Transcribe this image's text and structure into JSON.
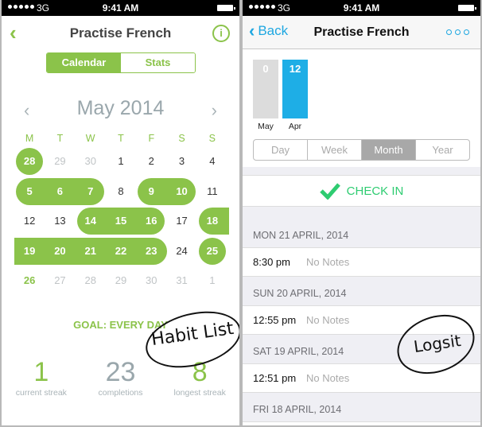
{
  "status_bar": {
    "carrier": "3G",
    "time": "9:41 AM"
  },
  "left": {
    "nav": {
      "back_icon": "chevron-left-icon",
      "title": "Practise French",
      "info_icon": "info-icon",
      "info_glyph": "i"
    },
    "segment": {
      "active": "Calendar",
      "inactive": "Stats"
    },
    "calendar": {
      "month_title": "May 2014",
      "prev_glyph": "‹",
      "next_glyph": "›",
      "weekdays": [
        "M",
        "T",
        "W",
        "T",
        "F",
        "S",
        "S"
      ],
      "weeks": [
        [
          {
            "d": "28",
            "s": "on"
          },
          {
            "d": "29",
            "s": "muted"
          },
          {
            "d": "30",
            "s": "muted"
          },
          {
            "d": "1",
            "s": "dark"
          },
          {
            "d": "2",
            "s": "dark"
          },
          {
            "d": "3",
            "s": "dark"
          },
          {
            "d": "4",
            "s": "dark"
          }
        ],
        [
          {
            "d": "5",
            "s": "on"
          },
          {
            "d": "6",
            "s": "on"
          },
          {
            "d": "7",
            "s": "on"
          },
          {
            "d": "8",
            "s": "dark"
          },
          {
            "d": "9",
            "s": "on"
          },
          {
            "d": "10",
            "s": "on"
          },
          {
            "d": "11",
            "s": "dark"
          }
        ],
        [
          {
            "d": "12",
            "s": "dark"
          },
          {
            "d": "13",
            "s": "dark"
          },
          {
            "d": "14",
            "s": "on"
          },
          {
            "d": "15",
            "s": "on"
          },
          {
            "d": "16",
            "s": "on"
          },
          {
            "d": "17",
            "s": "dark"
          },
          {
            "d": "18",
            "s": "on"
          }
        ],
        [
          {
            "d": "19",
            "s": "on"
          },
          {
            "d": "20",
            "s": "on"
          },
          {
            "d": "21",
            "s": "on"
          },
          {
            "d": "22",
            "s": "on"
          },
          {
            "d": "23",
            "s": "on"
          },
          {
            "d": "24",
            "s": "dark"
          },
          {
            "d": "25",
            "s": "on"
          }
        ],
        [
          {
            "d": "26",
            "s": "today"
          },
          {
            "d": "27",
            "s": "muted"
          },
          {
            "d": "28",
            "s": "muted"
          },
          {
            "d": "29",
            "s": "muted"
          },
          {
            "d": "30",
            "s": "muted"
          },
          {
            "d": "31",
            "s": "muted"
          },
          {
            "d": "1",
            "s": "muted"
          }
        ]
      ]
    },
    "goal": "GOAL: EVERY DAY",
    "stats": [
      {
        "value": "1",
        "label": "current streak",
        "color": "green"
      },
      {
        "value": "23",
        "label": "completions",
        "color": "gray"
      },
      {
        "value": "8",
        "label": "longest streak",
        "color": "green"
      }
    ],
    "annotation": "Habit List"
  },
  "right": {
    "nav": {
      "back_label": "Back",
      "title": "Practise French",
      "more_icon": "more-icon"
    },
    "chart_data": {
      "type": "bar",
      "categories": [
        "May",
        "Apr"
      ],
      "values": [
        0,
        12
      ],
      "colors": [
        "#dcdcdc",
        "#1eaee6"
      ]
    },
    "range_tabs": [
      "Day",
      "Week",
      "Month",
      "Year"
    ],
    "range_selected": "Month",
    "check_in_label": "CHECK IN",
    "log": [
      {
        "date": "MON 21 APRIL, 2014",
        "entries": [
          {
            "time": "8:30 pm",
            "note": "No Notes"
          }
        ]
      },
      {
        "date": "SUN 20 APRIL, 2014",
        "entries": [
          {
            "time": "12:55 pm",
            "note": "No Notes"
          }
        ]
      },
      {
        "date": "SAT 19 APRIL, 2014",
        "entries": [
          {
            "time": "12:51 pm",
            "note": "No Notes"
          }
        ]
      },
      {
        "date": "FRI 18 APRIL, 2014",
        "entries": []
      }
    ],
    "annotation": "Logsit"
  },
  "colors": {
    "habit_green": "#8bc34a",
    "logsit_blue": "#1ea7e1",
    "checkin_green": "#2ecc71"
  }
}
